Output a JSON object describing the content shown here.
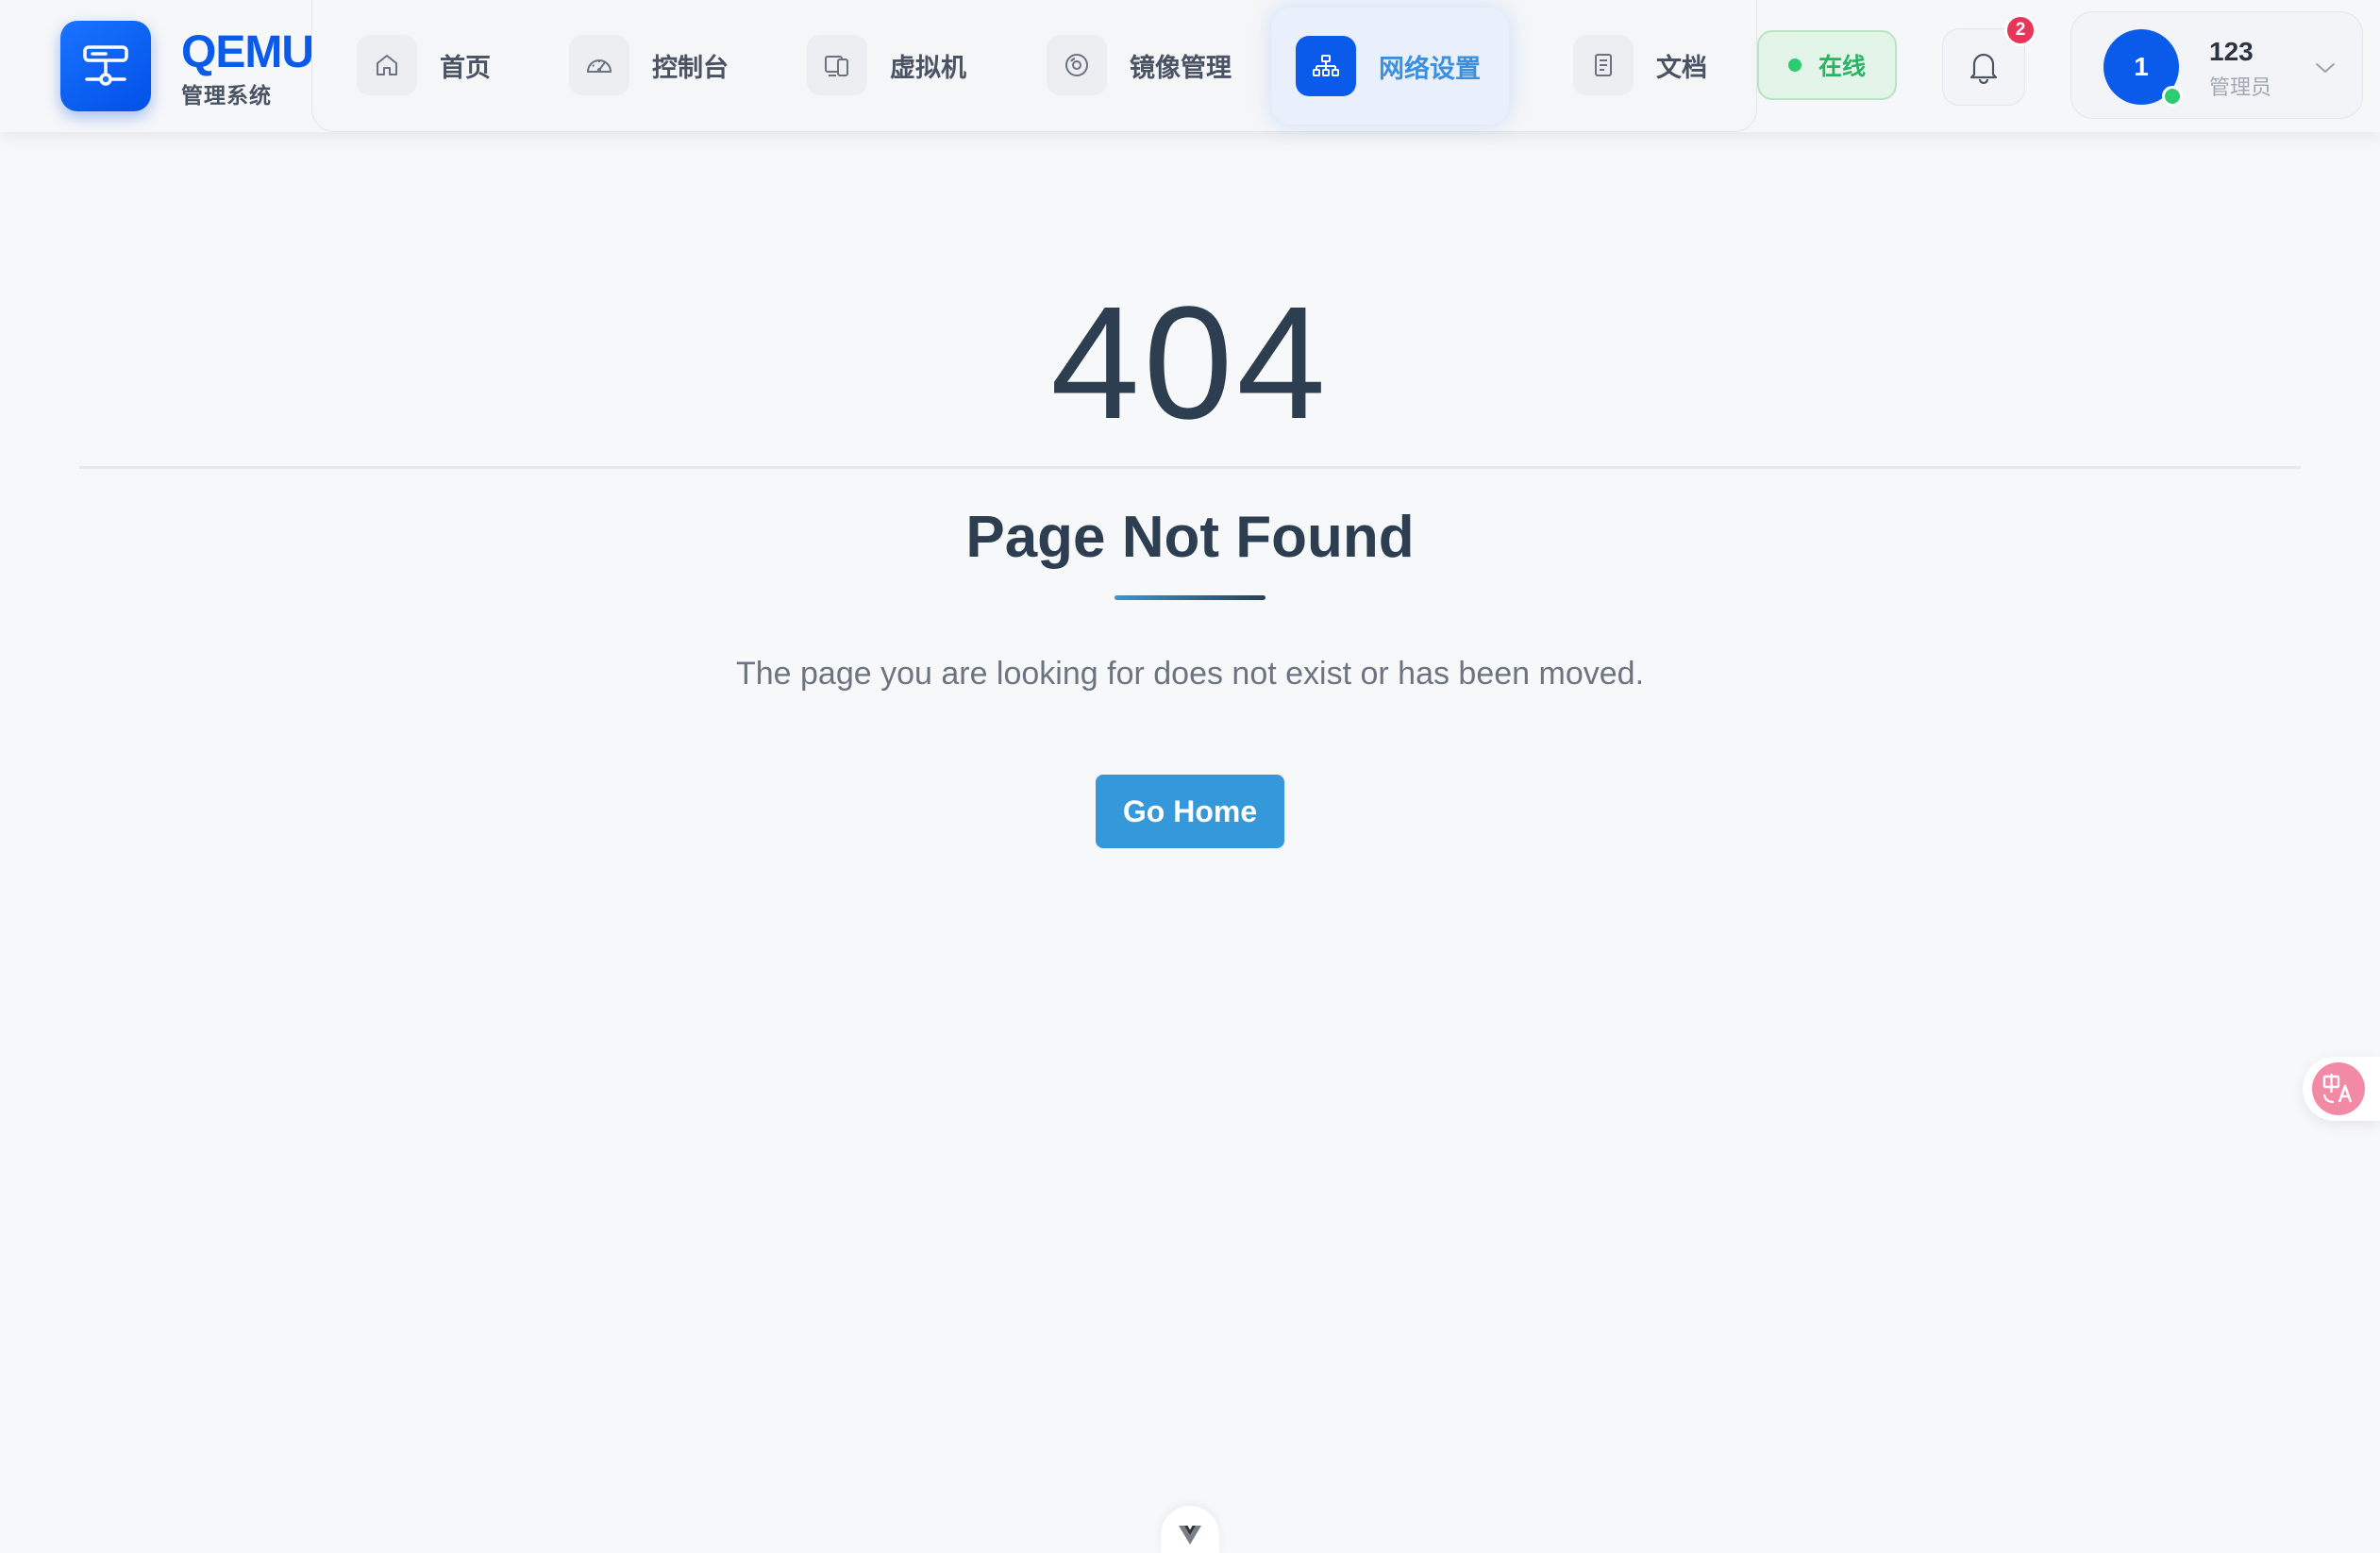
{
  "brand": {
    "title": "QEMU",
    "subtitle": "管理系统"
  },
  "nav": {
    "items": [
      {
        "label": "首页",
        "icon": "home-icon",
        "active": false
      },
      {
        "label": "控制台",
        "icon": "dashboard-gauge-icon",
        "active": false
      },
      {
        "label": "虚拟机",
        "icon": "devices-icon",
        "active": false
      },
      {
        "label": "镜像管理",
        "icon": "disc-icon",
        "active": false
      },
      {
        "label": "网络设置",
        "icon": "network-icon",
        "active": true
      },
      {
        "label": "文档",
        "icon": "document-icon",
        "active": false
      }
    ]
  },
  "status": {
    "label": "在线",
    "color": "#2ecc71"
  },
  "notifications": {
    "count": "2"
  },
  "user": {
    "avatar_text": "1",
    "name": "123",
    "role": "管理员"
  },
  "error": {
    "code": "404",
    "title": "Page Not Found",
    "message": "The page you are looking for does not exist or has been moved.",
    "button_label": "Go Home"
  },
  "colors": {
    "brand_blue": "#0b5bea",
    "accent_blue": "#3498db",
    "text_dark": "#2c3e50",
    "badge_red": "#e8365a"
  }
}
